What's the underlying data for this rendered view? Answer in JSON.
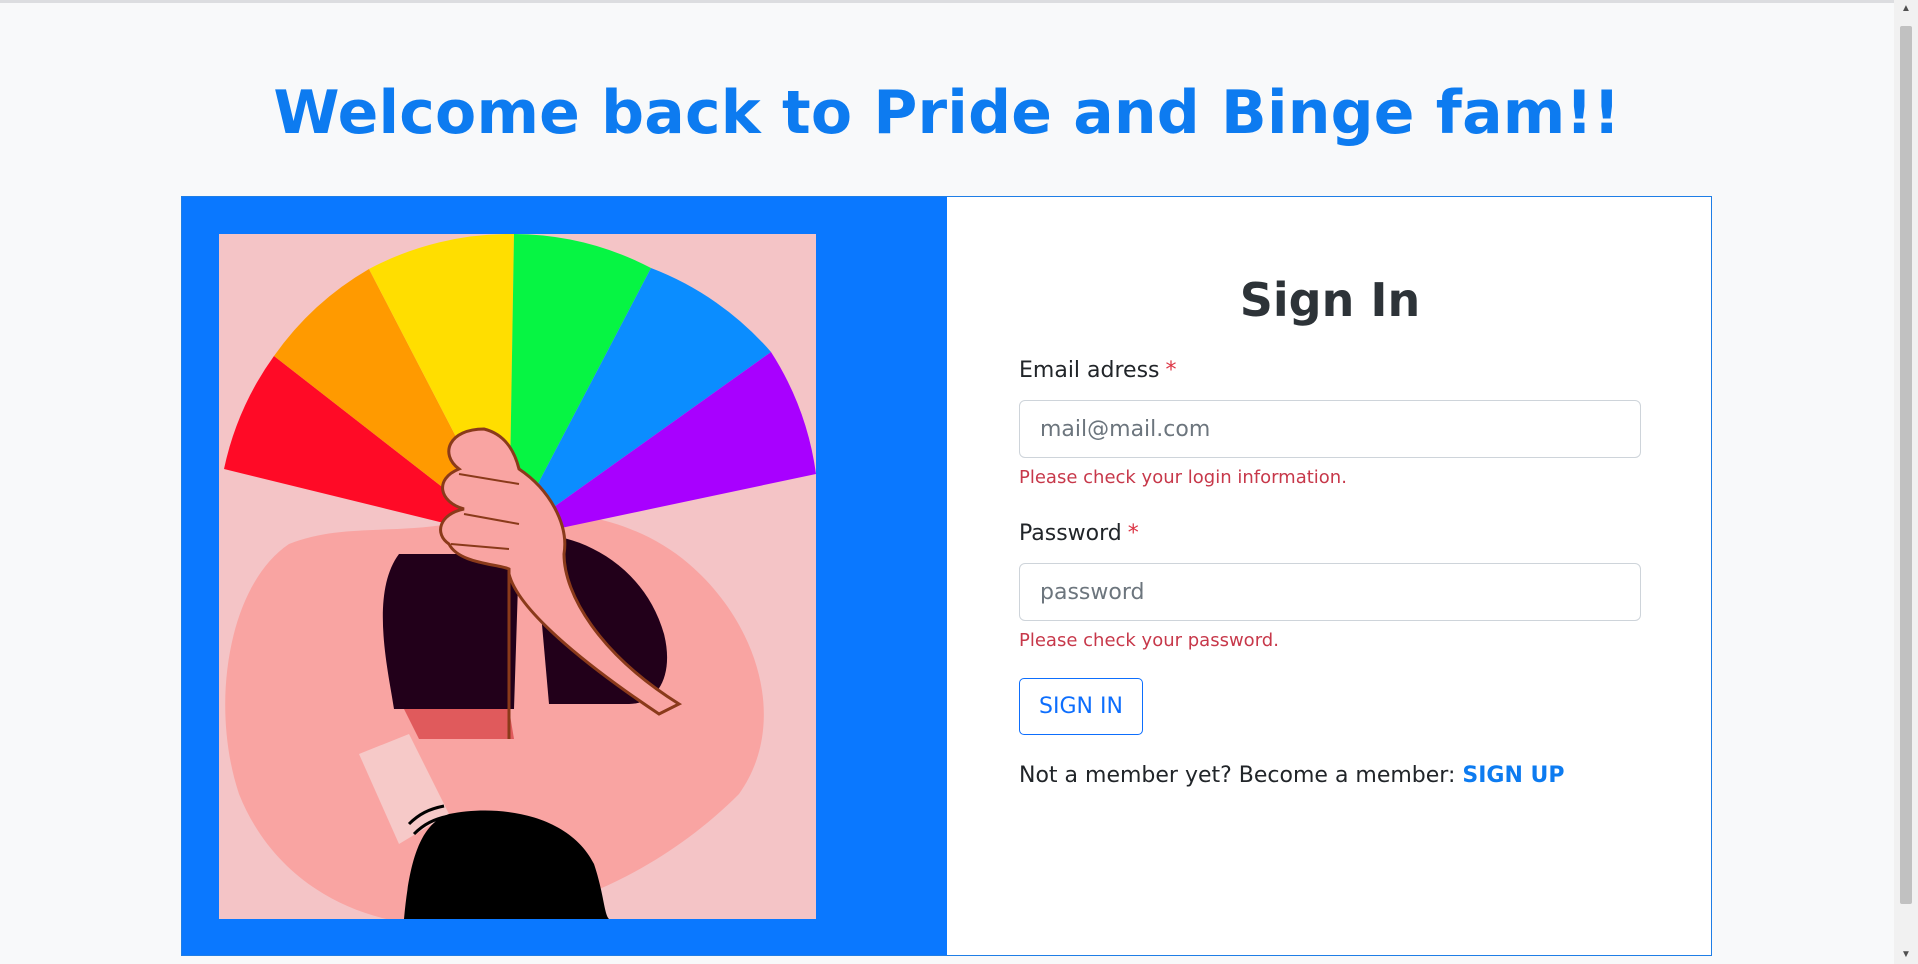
{
  "page": {
    "heading": "Welcome back to Pride and Binge fam!!"
  },
  "signin": {
    "title": "Sign In",
    "email_label": "Email adress",
    "email_required_mark": "*",
    "email_placeholder": "mail@mail.com",
    "email_value": "",
    "email_error": "Please check your login information.",
    "password_label": "Password",
    "password_required_mark": "*",
    "password_placeholder": "password",
    "password_value": "",
    "password_error": "Please check your password.",
    "submit_label": "SIGN IN",
    "member_prompt": "Not a member yet? Become a member: ",
    "signup_link": "SIGN UP"
  },
  "colors": {
    "brand_blue": "#0d7bf0",
    "panel_blue": "#0a78ff",
    "error_red": "#c7384a"
  },
  "icons": {
    "illustration": "rainbow-fan-illustration",
    "scroll_up": "scroll-up-arrow-icon",
    "scroll_down": "scroll-down-arrow-icon"
  }
}
